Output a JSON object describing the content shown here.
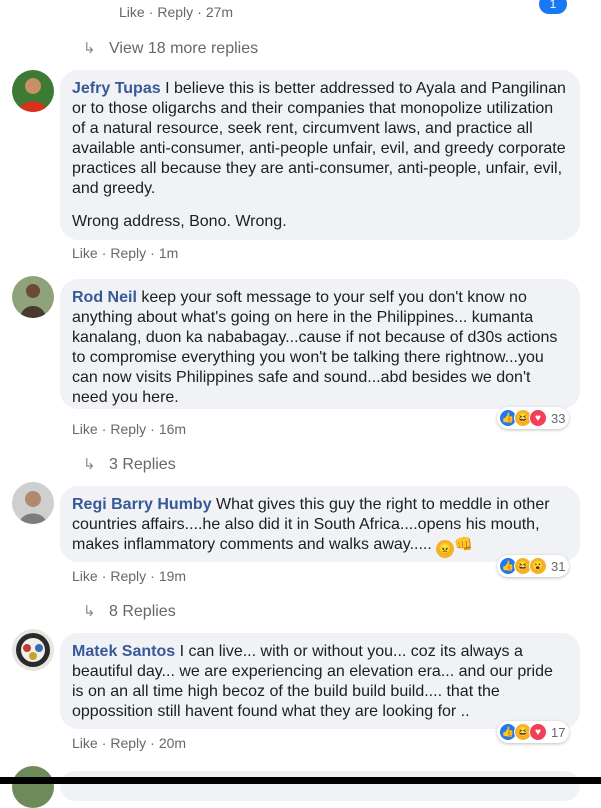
{
  "top": {
    "meta": {
      "like": "Like",
      "reply": "Reply",
      "time": "27m"
    },
    "badge": "1",
    "view_more": "View 18 more replies"
  },
  "comments": [
    {
      "author": "Jefry Tupas",
      "text": "I believe this is better addressed to Ayala and Pangilinan or to those oligarchs and their companies that monopolize utilization of a natural resource, seek rent, circumvent laws, and practice all available anti-consumer, anti-people unfair, evil, and greedy corporate practices all because they are anti-consumer, anti-people, unfair, evil, and greedy.",
      "text2": "Wrong address, Bono. Wrong.",
      "like": "Like",
      "reply": "Reply",
      "time": "1m"
    },
    {
      "author": "Rod Neil",
      "text": "keep your soft message to your self you don't know no anything about what's going on here in the Philippines... kumanta kanalang, duon ka nababagay...cause if not because of d30s actions to compromise everything you won't be talking there rightnow...you can now visits Philippines safe and sound...abd besides we don't need you here.",
      "like": "Like",
      "reply": "Reply",
      "time": "16m",
      "reaction_count": "33",
      "replies": "3 Replies"
    },
    {
      "author": "Regi Barry Humby",
      "text": "What gives this guy the right to meddle in other countries affairs....he also did it in South Africa....opens his mouth, makes inflammatory comments and walks away.....",
      "like": "Like",
      "reply": "Reply",
      "time": "19m",
      "reaction_count": "31",
      "replies": "8 Replies"
    },
    {
      "author": "Matek Santos",
      "text": "I can live... with or without you... coz its always a beautiful day... we are experiencing an elevation era... and our pride is on an all time high becoz of the build build build.... that the oppossition still havent found what they are looking for ..",
      "like": "Like",
      "reply": "Reply",
      "time": "20m",
      "reaction_count": "17"
    }
  ],
  "colors": {
    "author": "#385898",
    "bubble": "#f0f2f5",
    "meta": "#65676b"
  }
}
